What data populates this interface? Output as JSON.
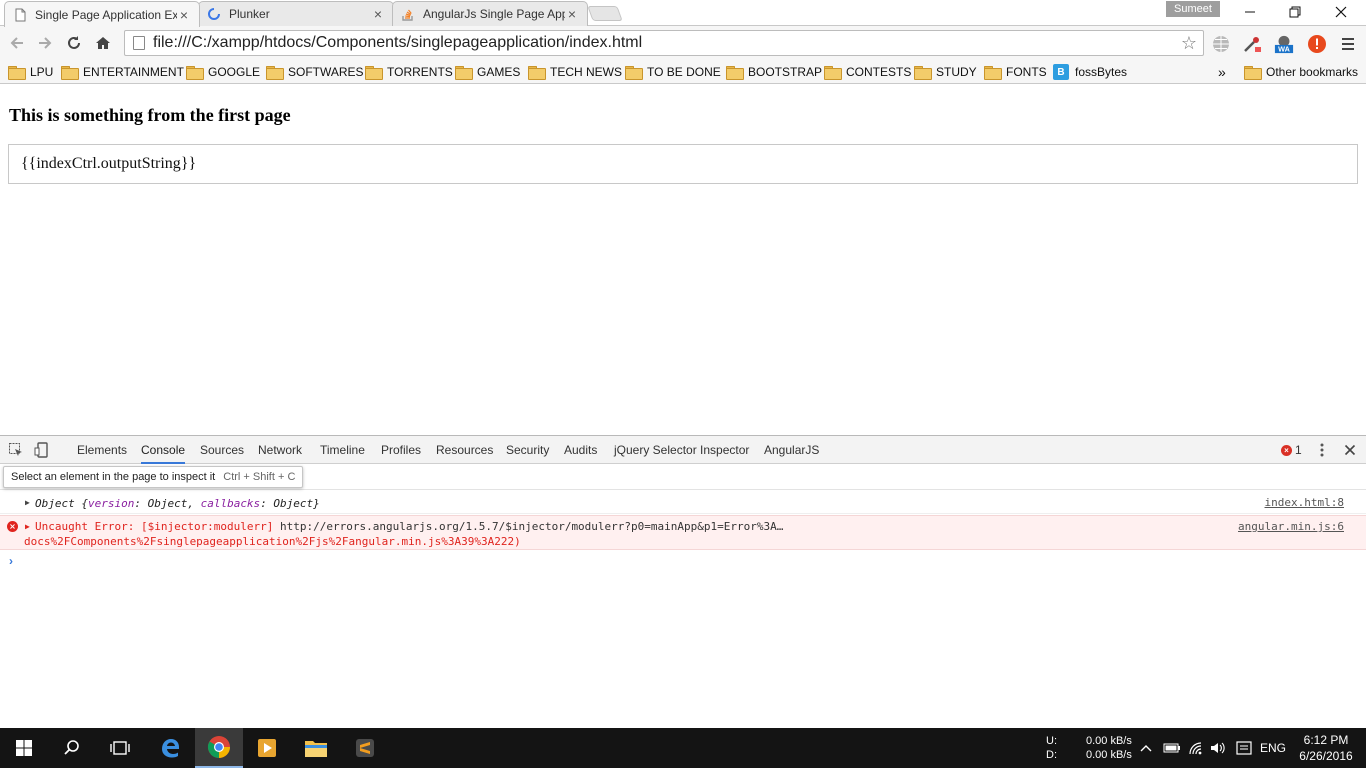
{
  "browser": {
    "tabs": [
      {
        "title": "Single Page Application Ex",
        "icon": "page-icon",
        "active": true
      },
      {
        "title": "Plunker",
        "icon": "loading-icon",
        "active": false
      },
      {
        "title": "AngularJs Single Page App",
        "icon": "stackoverflow-icon",
        "active": false
      }
    ],
    "profile_name": "Sumeet",
    "url": "file:///C:/xampp/htdocs/Components/singlepageapplication/index.html",
    "extension_badge": "WA",
    "bookmarks": [
      {
        "label": "LPU",
        "type": "folder"
      },
      {
        "label": "ENTERTAINMENT",
        "type": "folder"
      },
      {
        "label": "GOOGLE",
        "type": "folder"
      },
      {
        "label": "SOFTWARES",
        "type": "folder"
      },
      {
        "label": "TORRENTS",
        "type": "folder"
      },
      {
        "label": "GAMES",
        "type": "folder"
      },
      {
        "label": "TECH NEWS",
        "type": "folder"
      },
      {
        "label": "TO BE DONE",
        "type": "folder"
      },
      {
        "label": "BOOTSTRAP",
        "type": "folder"
      },
      {
        "label": "CONTESTS",
        "type": "folder"
      },
      {
        "label": "STUDY",
        "type": "folder"
      },
      {
        "label": "FONTS",
        "type": "folder"
      },
      {
        "label": "fossBytes",
        "type": "site",
        "icon_letter": "B"
      }
    ],
    "bookmarks_overflow": "»",
    "other_bookmarks": "Other bookmarks"
  },
  "page": {
    "heading": "This is something from the first page",
    "output": "{{indexCtrl.outputString}}"
  },
  "devtools": {
    "tabs": [
      "Elements",
      "Console",
      "Sources",
      "Network",
      "Timeline",
      "Profiles",
      "Resources",
      "Security",
      "Audits",
      "jQuery Selector Inspector",
      "AngularJS"
    ],
    "active_tab": "Console",
    "error_count": "1",
    "tooltip_text": "Select an element in the page to inspect it",
    "tooltip_shortcut": "Ctrl + Shift + C",
    "console": {
      "log_prefix": "Object ",
      "log_open": "{",
      "log_key1": "version",
      "log_sep1": ": Object, ",
      "log_key2": "callbacks",
      "log_sep2": ": Object}",
      "log_source": "index.html:8",
      "error_prefix": "Uncaught Error: [$injector:modulerr] ",
      "error_url": "http://errors.angularjs.org/1.5.7/$injector/modulerr?p0=mainApp&p1=Error%3A…",
      "error_line2": "docs%2FComponents%2Fsinglepageapplication%2Fjs%2Fangular.min.js%3A39%3A222)",
      "error_source": "angular.min.js:6",
      "prompt": "›"
    }
  },
  "taskbar": {
    "net_up_label": "U:",
    "net_down_label": "D:",
    "net_up": "0.00 kB/s",
    "net_down": "0.00 kB/s",
    "language": "ENG",
    "time": "6:12 PM",
    "date": "6/26/2016"
  },
  "colors": {
    "accent": "#3879d9",
    "error": "#e0241e",
    "error_bg": "#fff0f0",
    "taskbar": "#141414"
  }
}
